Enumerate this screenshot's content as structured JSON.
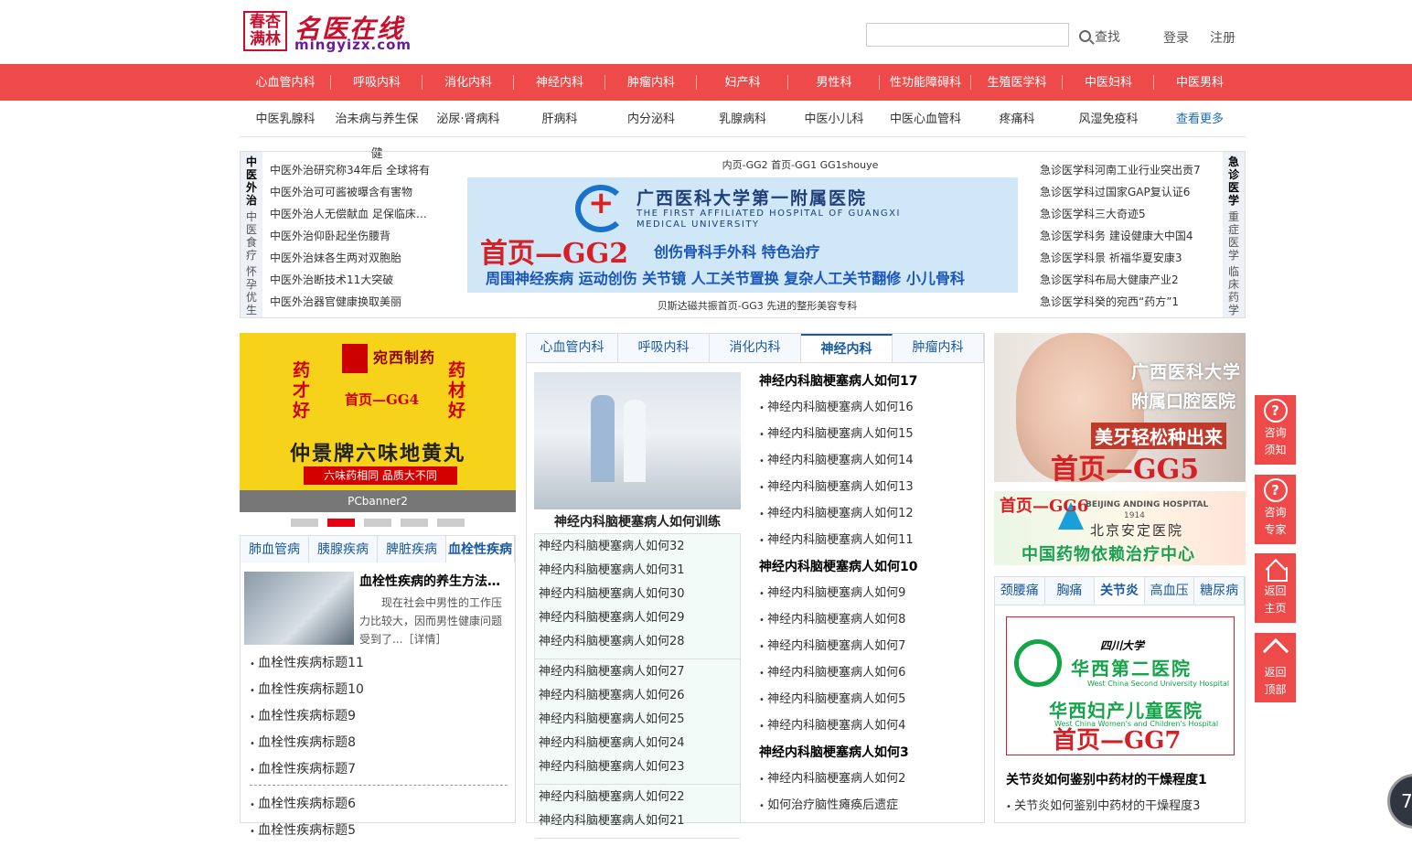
{
  "logo": {
    "seal": "春杏满林",
    "name": "名医在线",
    "url": "mingyizx.com"
  },
  "header": {
    "search_placeholder": "",
    "search_label": "查找",
    "login": "登录",
    "register": "注册"
  },
  "nav_primary": [
    "心血管内科",
    "呼吸内科",
    "消化内科",
    "神经内科",
    "肿瘤内科",
    "妇产科",
    "男性科",
    "性功能障碍科",
    "生殖医学科",
    "中医妇科",
    "中医男科"
  ],
  "nav_secondary": [
    "中医乳腺科",
    "治未病与养生保健",
    "泌尿·肾病科",
    "肝病科",
    "内分泌科",
    "乳腺病科",
    "中医小儿科",
    "中医心血管科",
    "疼痛科",
    "风湿免疫科",
    "查看更多"
  ],
  "left_vtab": {
    "active": "中医外治",
    "others": [
      "中医食疗",
      "怀孕优生"
    ]
  },
  "left_news": [
    "中医外治研究称34年后 全球将有",
    "中医外治可可酱被曝含有害物",
    "中医外治人无偿献血 足保临床…",
    "中医外治仰卧起坐伤腰背",
    "中医外治妹各生两对双胞胎",
    "中医外治断技术11大突破",
    "中医外治器官健康换取美丽"
  ],
  "ad_top": "内页-GG2   首页-GG1   GG1shouye",
  "ad_gg2": {
    "hospital": "广西医科大学第一附属医院",
    "hospital_en": "THE FIRST AFFILIATED HOSPITAL OF GUANGXI MEDICAL UNIVERSITY",
    "tag": "首页—GG2",
    "line1": "创伤骨科手外科  特色治疗",
    "line2": "周围神经疾病 运动创伤  关节镜 人工关节置换  复杂人工关节翻修 小儿骨科"
  },
  "ad_bottom": "贝斯达磁共振首页-GG3   先进的整形美容专科",
  "right_vtab": {
    "active": "急诊医学",
    "others": [
      "重症医学",
      "临床药学"
    ]
  },
  "right_news": [
    "急诊医学科河南工业行业突出贡7",
    "急诊医学科过国家GAP复认证6",
    "急诊医学科三大奇迹5",
    "急诊医学科务 建设健康大中国4",
    "急诊医学科景 祈福华夏安康3",
    "急诊医学科布局大健康产业2",
    "急诊医学科癸的宛西“药方”1"
  ],
  "banner": {
    "brand": "宛西制药",
    "slogan_left": "药才好",
    "slogan_right": "药材好",
    "tag": "首页—GG4",
    "product": "仲景牌六味地黄丸",
    "strip": "六味药相同  品质大不同",
    "caption": "PCbanner2",
    "active_dot": 1,
    "dot_count": 5
  },
  "left_tabs": [
    "肺血管病",
    "胰腺疾病",
    "脾脏疾病",
    "血栓性疾病"
  ],
  "left_tabs_active": 3,
  "left_panel": {
    "title": "血栓性疾病的养生方法…",
    "desc": "现在社会中男性的工作压力比较大，因而男性健康问题受到了...［详情］",
    "items_a": [
      "血栓性疾病标题11",
      "血栓性疾病标题10",
      "血栓性疾病标题9",
      "血栓性疾病标题8",
      "血栓性疾病标题7"
    ],
    "items_b": [
      "血栓性疾病标题6",
      "血栓性疾病标题5"
    ]
  },
  "mid_tabs": [
    "心血管内科",
    "呼吸内科",
    "消化内科",
    "神经内科",
    "肿瘤内科"
  ],
  "mid_tabs_active": 3,
  "mid": {
    "img_caption": "神经内科脑梗塞病人如何训练",
    "groups": [
      [
        "神经内科脑梗塞病人如何32",
        "神经内科脑梗塞病人如何31",
        "神经内科脑梗塞病人如何30",
        "神经内科脑梗塞病人如何29",
        "神经内科脑梗塞病人如何28"
      ],
      [
        "神经内科脑梗塞病人如何27",
        "神经内科脑梗塞病人如何26",
        "神经内科脑梗塞病人如何25",
        "神经内科脑梗塞病人如何24",
        "神经内科脑梗塞病人如何23"
      ],
      [
        "神经内科脑梗塞病人如何22",
        "神经内科脑梗塞病人如何21"
      ]
    ],
    "right": [
      {
        "t": "神经内科脑梗塞病人如何17",
        "h": true
      },
      {
        "t": "神经内科脑梗塞病人如何16",
        "h": false
      },
      {
        "t": "神经内科脑梗塞病人如何15",
        "h": false
      },
      {
        "t": "神经内科脑梗塞病人如何14",
        "h": false
      },
      {
        "t": "神经内科脑梗塞病人如何13",
        "h": false
      },
      {
        "t": "神经内科脑梗塞病人如何12",
        "h": false
      },
      {
        "t": "神经内科脑梗塞病人如何11",
        "h": false
      },
      {
        "t": "神经内科脑梗塞病人如何10",
        "h": true
      },
      {
        "t": "神经内科脑梗塞病人如何9",
        "h": false
      },
      {
        "t": "神经内科脑梗塞病人如何8",
        "h": false
      },
      {
        "t": "神经内科脑梗塞病人如何7",
        "h": false
      },
      {
        "t": "神经内科脑梗塞病人如何6",
        "h": false
      },
      {
        "t": "神经内科脑梗塞病人如何5",
        "h": false
      },
      {
        "t": "神经内科脑梗塞病人如何4",
        "h": false
      },
      {
        "t": "神经内科脑梗塞病人如何3",
        "h": true
      },
      {
        "t": "神经内科脑梗塞病人如何2",
        "h": false
      },
      {
        "t": "如何治疗脑性瘫痪后遗症",
        "h": false
      }
    ]
  },
  "gg5": {
    "t1": "广西医科大学",
    "t2": "附属口腔医院",
    "t3": "美牙轻松种出来",
    "tag": "首页—GG5"
  },
  "gg6": {
    "tag": "首页—GG6",
    "en": "BEIJING ANDING HOSPITAL",
    "year": "1914",
    "cn": "北京安定医院",
    "big": "中国药物依赖治疗中心"
  },
  "right_tabs": [
    "颈腰痛",
    "胸痛",
    "关节炎",
    "高血压",
    "糖尿病"
  ],
  "right_tabs_active": 2,
  "gg7": {
    "sc": "四川大学",
    "h1": "华西第二医院",
    "e1": "West China Second University Hospital",
    "h2": "华西妇产儿童医院",
    "e2": "West China Women's and Children's Hospital",
    "tag": "首页—GG7"
  },
  "right_panel": {
    "title": "关节炎如何鉴别中药材的干燥程度1",
    "item": "关节炎如何鉴别中药材的干燥程度3"
  },
  "float": [
    {
      "icon": "?",
      "label": "咨询须知"
    },
    {
      "icon": "?",
      "label": "咨询专家"
    },
    {
      "icon": "home",
      "label": "返回主页"
    },
    {
      "icon": "up",
      "label": "返回顶部"
    }
  ],
  "corner": "7",
  "colors": {
    "brand_red": "#ef4a4a",
    "link_blue": "#1a5aa0"
  }
}
